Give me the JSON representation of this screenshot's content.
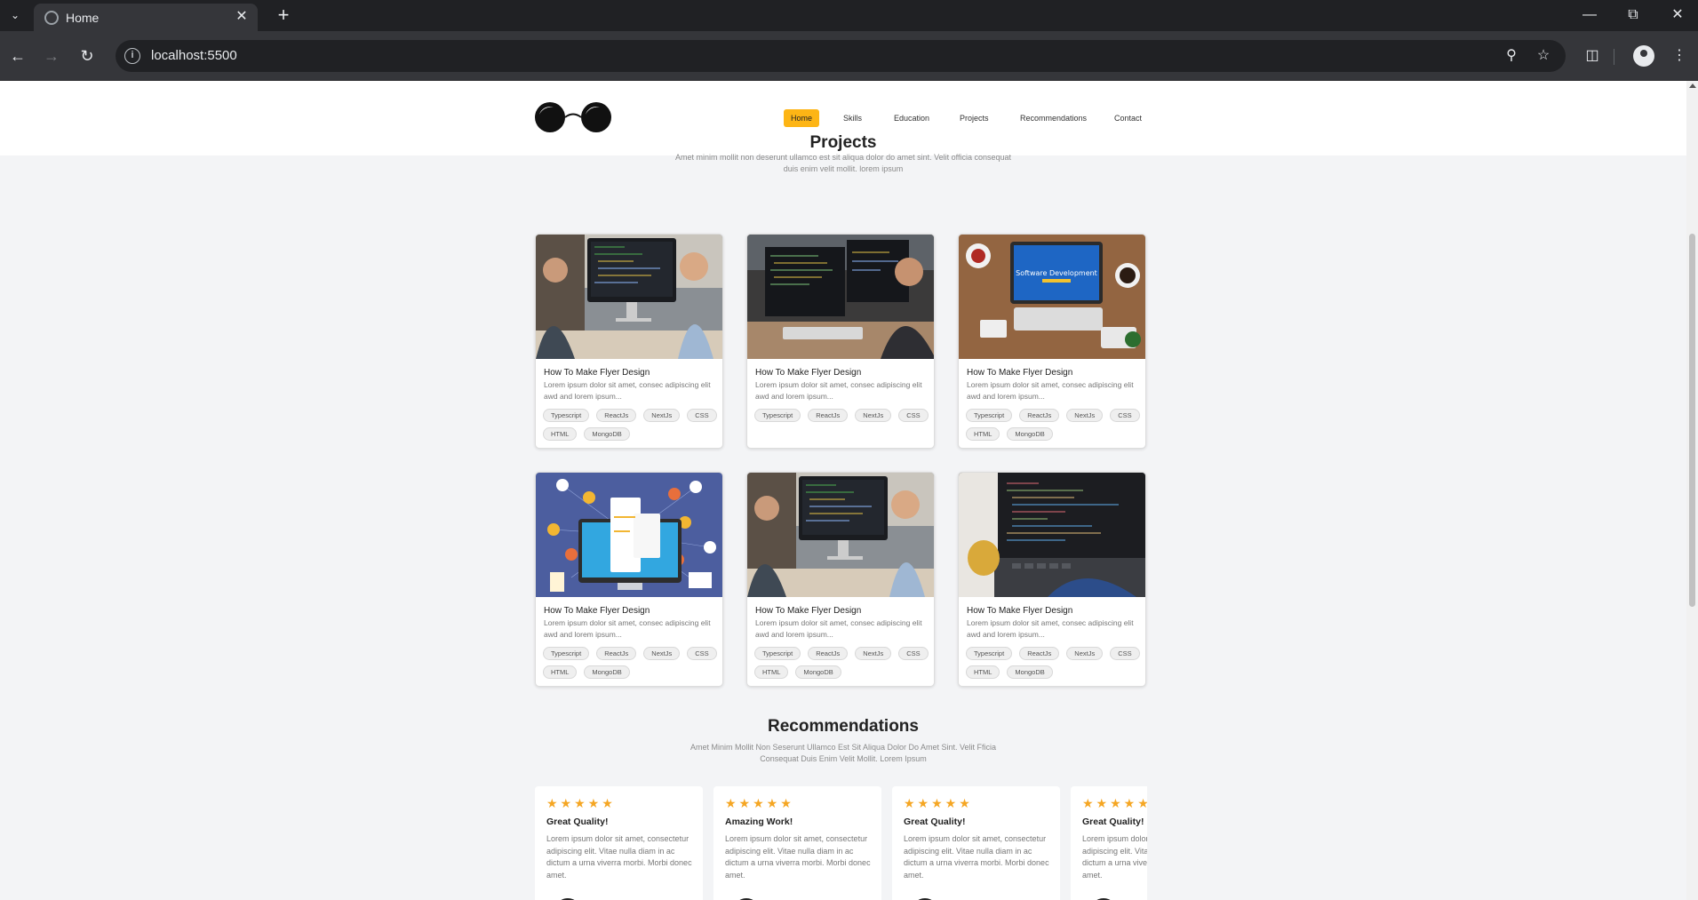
{
  "browser": {
    "tab_title": "Home",
    "url": "localhost:5500"
  },
  "nav": {
    "items": [
      "Home",
      "Skills",
      "Education",
      "Projects",
      "Recommendations",
      "Contact"
    ],
    "active": "Home",
    "accent_color": "#fdb515"
  },
  "projects": {
    "title": "Projects",
    "subtitle": "Amet minim mollit non deserunt ullamco est sit aliqua dolor do amet sint. Velit officia consequat duis enim velit mollit. lorem ipsum",
    "cards": [
      {
        "title": "How To Make Flyer Design",
        "desc": "Lorem ipsum dolor sit amet, consec adipiscing elit awd and lorem ipsum...",
        "tags": [
          "Typescript",
          "ReactJs",
          "NextJs",
          "CSS",
          "HTML",
          "MongoDB"
        ],
        "image": "developers-at-desk"
      },
      {
        "title": "How To Make Flyer Design",
        "desc": "Lorem ipsum dolor sit amet, consec adipiscing elit awd and lorem ipsum...",
        "tags": [
          "Typescript",
          "ReactJs",
          "NextJs",
          "CSS"
        ],
        "image": "developer-multi-monitor"
      },
      {
        "title": "How To Make Flyer Design",
        "desc": "Lorem ipsum dolor sit amet, consec adipiscing elit awd and lorem ipsum...",
        "tags": [
          "Typescript",
          "ReactJs",
          "NextJs",
          "CSS",
          "HTML",
          "MongoDB"
        ],
        "image": "software-development-laptop",
        "image_caption": "Software Development"
      },
      {
        "title": "How To Make Flyer Design",
        "desc": "Lorem ipsum dolor sit amet, consec adipiscing elit awd and lorem ipsum...",
        "tags": [
          "Typescript",
          "ReactJs",
          "NextJs",
          "CSS",
          "HTML",
          "MongoDB"
        ],
        "image": "computer-illustration"
      },
      {
        "title": "How To Make Flyer Design",
        "desc": "Lorem ipsum dolor sit amet, consec adipiscing elit awd and lorem ipsum...",
        "tags": [
          "Typescript",
          "ReactJs",
          "NextJs",
          "CSS",
          "HTML",
          "MongoDB"
        ],
        "image": "developers-at-desk"
      },
      {
        "title": "How To Make Flyer Design",
        "desc": "Lorem ipsum dolor sit amet, consec adipiscing elit awd and lorem ipsum...",
        "tags": [
          "Typescript",
          "ReactJs",
          "NextJs",
          "CSS",
          "HTML",
          "MongoDB"
        ],
        "image": "laptop-code-coffee"
      }
    ]
  },
  "recommendations": {
    "title": "Recommendations",
    "subtitle": "Amet Minim Mollit Non Seserunt Ullamco Est Sit Aliqua Dolor Do Amet Sint. Velit Fficia Consequat Duis Enim Velit Mollit. Lorem Ipsum",
    "star_color": "#f5a623",
    "cards": [
      {
        "rating": 5,
        "title": "Great Quality!",
        "text": "Lorem ipsum dolor sit amet, consectetur adipiscing elit. Vitae nulla diam in ac dictum a urna viverra morbi. Morbi donec amet."
      },
      {
        "rating": 5,
        "title": "Amazing Work!",
        "text": "Lorem ipsum dolor sit amet, consectetur adipiscing elit. Vitae nulla diam in ac dictum a urna viverra morbi. Morbi donec amet."
      },
      {
        "rating": 5,
        "title": "Great Quality!",
        "text": "Lorem ipsum dolor sit amet, consectetur adipiscing elit. Vitae nulla diam in ac dictum a urna viverra morbi. Morbi donec amet."
      },
      {
        "rating": 5,
        "title": "Great Quality!",
        "text": "Lorem ipsum dolor sit amet, consectetur adipiscing elit. Vitae nulla diam in ac dictum a urna viverra morbi. Morbi donec amet."
      }
    ]
  }
}
